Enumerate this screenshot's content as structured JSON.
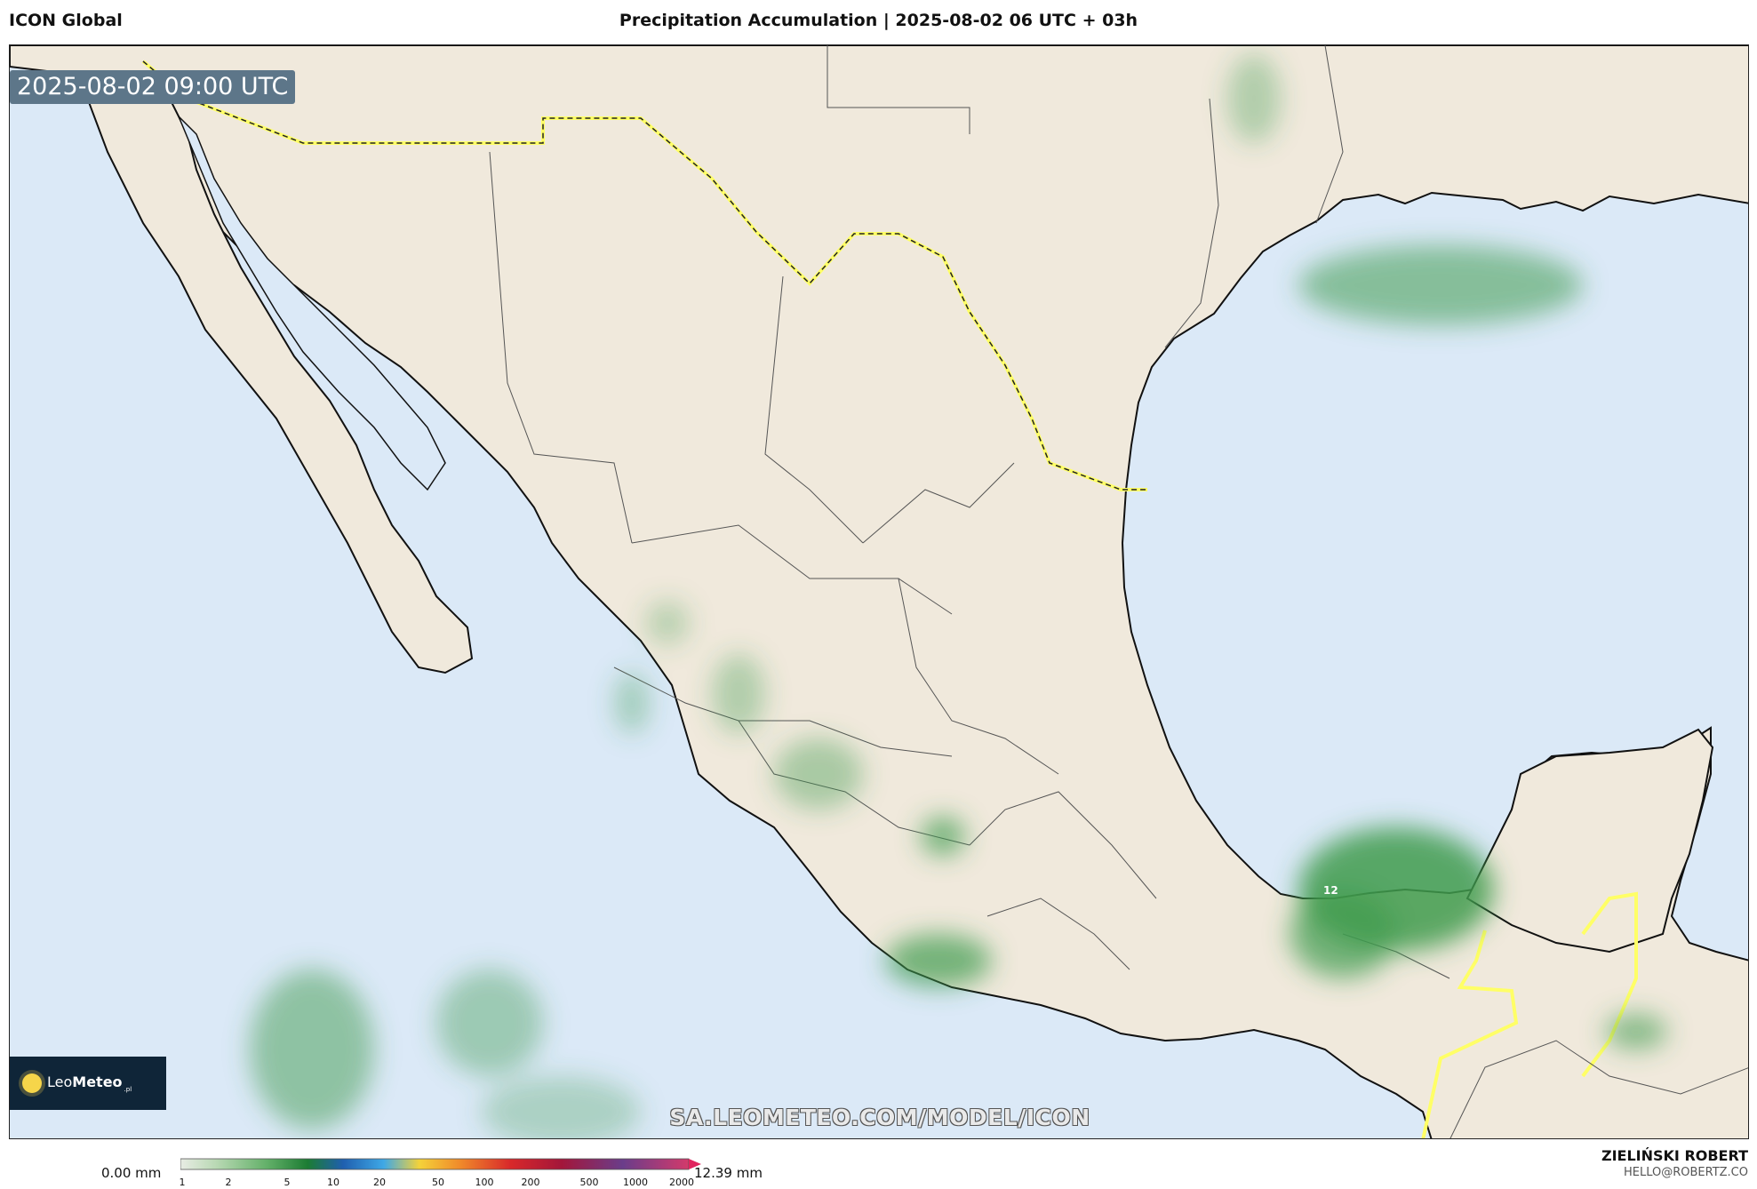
{
  "header": {
    "model": "ICON Global",
    "title": "Precipitation Accumulation | 2025-08-02 06 UTC + 03h"
  },
  "map": {
    "timestamp": "2025-08-02 09:00 UTC",
    "watermark": "SA.LEOMETEO.COM/MODEL/ICON",
    "max_label": "12",
    "colors": {
      "ocean": "#dbe9f7",
      "land": "#f0e9dc",
      "border": "#ffff66",
      "precip": "#2e8b3e"
    }
  },
  "brand": {
    "name_light": "Leo",
    "name_bold": "Meteo",
    "suffix": ".pl"
  },
  "legend": {
    "min_label": "0.00 mm",
    "max_label": "12.39 mm",
    "ticks": [
      "1",
      "2",
      "5",
      "10",
      "20",
      "50",
      "100",
      "200",
      "500",
      "1000",
      "2000"
    ]
  },
  "author": {
    "name": "ZIELIŃSKI ROBERT",
    "email": "HELLO@ROBERTZ.CO"
  }
}
